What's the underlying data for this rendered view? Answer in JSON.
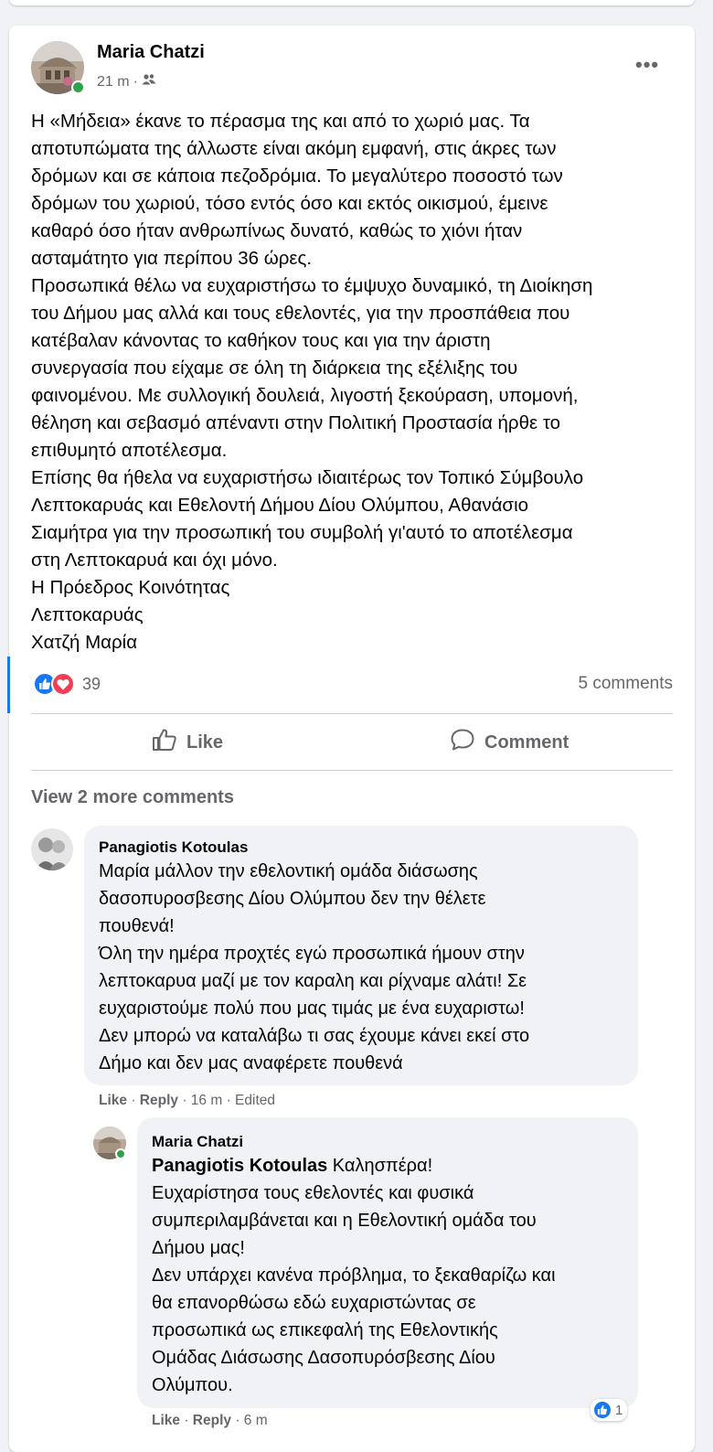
{
  "post": {
    "author": "Maria Chatzi",
    "time": "21 m",
    "dot": "·",
    "more_label": "•••",
    "text_lines": [
      "Η «Μήδεια» έκανε το πέρασμα της και από το χωριό μας. Τα",
      "αποτυπώματα της άλλωστε είναι ακόμη εμφανή, στις άκρες των",
      "δρόμων και σε κάποια πεζοδρόμια. Το μεγαλύτερο ποσοστό των",
      "δρόμων του χωριού, τόσο εντός όσο και εκτός οικισμού, έμεινε",
      "καθαρό όσο ήταν ανθρωπίνως δυνατό, καθώς το χιόνι ήταν",
      "ασταμάτητο για περίπου 36 ώρες.",
      "Προσωπικά θέλω να ευχαριστήσω το έμψυχο δυναμικό, τη Διοίκηση",
      "του Δήμου μας αλλά και τους εθελοντές, για την προσπάθεια που",
      "κατέβαλαν κάνοντας το καθήκον τους και για την άριστη",
      "συνεργασία που είχαμε σε όλη τη διάρκεια της εξέλιξης του",
      "φαινομένου. Με συλλογική δουλειά, λιγοστή ξεκούραση, υπομονή,",
      "θέληση και σεβασμό απέναντι στην Πολιτική Προστασία ήρθε το",
      "επιθυμητό αποτέλεσμα.",
      "Επίσης θα ήθελα να ευχαριστήσω ιδιαιτέρως τον Τοπικό Σύμβουλο",
      "Λεπτοκαρυάς και Εθελοντή Δήμου Δίου Ολύμπου, Αθανάσιο",
      "Σιαμήτρα για την προσωπική του συμβολή γι'αυτό το αποτέλεσμα",
      "στη Λεπτοκαρυά και όχι μόνο.",
      "Η Πρόεδρος Κοινότητας",
      "Λεπτοκαρυάς",
      "Χατζή Μαρία"
    ],
    "reaction_count": "39",
    "comments_count": "5 comments",
    "like_label": "Like",
    "comment_label": "Comment",
    "view_more": "View 2 more comments"
  },
  "comments": [
    {
      "author": "Panagiotis Kotoulas",
      "lines": [
        "Μαρία μάλλον την εθελοντική ομάδα διάσωσης",
        "δασοπυροσβεσης Δίου Ολύμπου δεν την θέλετε",
        "πουθενά!",
        "Όλη την ημέρα προχτές εγώ προσωπικά ήμουν στην",
        "λεπτοκαρυα μαζί με τον καραλη και ρίχναμε αλάτι! Σε",
        "ευχαριστούμε πολύ που μας τιμάς με ένα ευχαριστω!",
        "Δεν μπορώ να καταλάβω τι σας έχουμε κάνει εκεί στο",
        "Δήμο και δεν μας αναφέρετε πουθενά"
      ],
      "like": "Like",
      "reply": "Reply",
      "time": "16 m",
      "edited": "Edited"
    },
    {
      "author": "Maria Chatzi",
      "mention": "Panagiotis Kotoulas",
      "first_line_rest": " Καλησπέρα!",
      "lines": [
        "Ευχαρίστησα τους εθελοντές και φυσικά",
        "συμπεριλαμβάνεται και η Εθελοντική ομάδα του",
        "Δήμου μας!",
        "Δεν υπάρχει κανένα πρόβλημα, το ξεκαθαρίζω και",
        "θα επανορθώσω εδώ ευχαριστώντας σε",
        "προσωπικά ως επικεφαλή της Εθελοντικής",
        "Ομάδας Διάσωσης Δασοπυρόσβεσης Δίου",
        "Ολύμπου."
      ],
      "reaction_count": "1",
      "like": "Like",
      "reply": "Reply",
      "time": "6 m"
    }
  ],
  "colors": {
    "accent": "#1877f2",
    "like_blue": "#1877f2",
    "love_red": "#f33e58",
    "online": "#31a24c",
    "secondary_text": "#65676b"
  }
}
